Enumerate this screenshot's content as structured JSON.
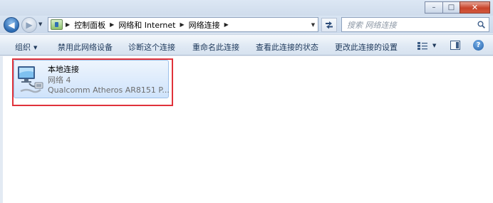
{
  "window": {
    "minimize_glyph": "–",
    "maximize_glyph": "□",
    "close_glyph": "✕"
  },
  "nav": {
    "back_glyph": "◀",
    "forward_glyph": "▶"
  },
  "address": {
    "breadcrumbs": [
      "控制面板",
      "网络和 Internet",
      "网络连接"
    ],
    "icon": "control-panel-icon"
  },
  "search": {
    "placeholder": "搜索 网络连接",
    "icon": "search-icon"
  },
  "toolbar": {
    "organize": "组织",
    "disable": "禁用此网络设备",
    "diagnose": "诊断这个连接",
    "rename": "重命名此连接",
    "status": "查看此连接的状态",
    "change_settings": "更改此连接的设置"
  },
  "connection": {
    "name": "本地连接",
    "network": "网络  4",
    "adapter": "Qualcomm Atheros AR8151 P...",
    "icon": "network-adapter-icon"
  },
  "colors": {
    "highlight_border": "#e0323a",
    "selection_fill": "#cfe3fb",
    "toolbar_text": "#1e395b"
  }
}
